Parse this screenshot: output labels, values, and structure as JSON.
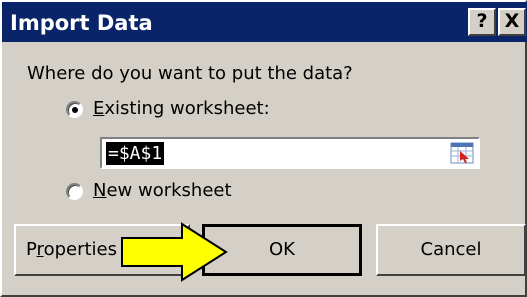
{
  "window": {
    "title": "Import Data",
    "help_label": "?",
    "close_label": "X"
  },
  "prompt": "Where do you want to put the data?",
  "options": {
    "existing_underline": "E",
    "existing_rest": "xisting worksheet:",
    "existing_selected": true,
    "new_underline": "N",
    "new_rest": "ew worksheet",
    "new_selected": false
  },
  "reference_field": {
    "value": "=$A$1"
  },
  "buttons": {
    "properties_pre": "P",
    "properties_underline": "r",
    "properties_post": "operties",
    "ok": "OK",
    "cancel": "Cancel"
  },
  "annotation": {
    "arrow_color": "#ffff00"
  }
}
